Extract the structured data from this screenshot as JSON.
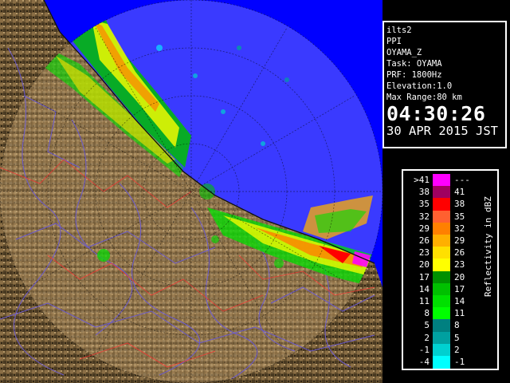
{
  "info": {
    "lines": [
      "ilts2",
      "PPI",
      "OYAMA_Z",
      "Task: OYAMA",
      "PRF: 1800Hz",
      "Elevation:1.0",
      "Max Range:80 km"
    ],
    "time": "04:30:26",
    "date": "30 APR 2015 JST"
  },
  "legend": {
    "title": "Reflectivity in dBZ",
    "rows": [
      {
        "low": ">41",
        "high": "---",
        "color": "#ff00ff"
      },
      {
        "low": "38",
        "high": "41",
        "color": "#a00060"
      },
      {
        "low": "35",
        "high": "38",
        "color": "#ff0000"
      },
      {
        "low": "32",
        "high": "35",
        "color": "#ff6030"
      },
      {
        "low": "29",
        "high": "32",
        "color": "#ff8000"
      },
      {
        "low": "26",
        "high": "29",
        "color": "#ffb000"
      },
      {
        "low": "23",
        "high": "26",
        "color": "#ffe000"
      },
      {
        "low": "20",
        "high": "23",
        "color": "#ffff00"
      },
      {
        "low": "17",
        "high": "20",
        "color": "#009000"
      },
      {
        "low": "14",
        "high": "17",
        "color": "#00c000"
      },
      {
        "low": "11",
        "high": "14",
        "color": "#00e000"
      },
      {
        "low": "8",
        "high": "11",
        "color": "#00ff00"
      },
      {
        "low": "5",
        "high": "8",
        "color": "#008080"
      },
      {
        "low": "2",
        "high": "5",
        "color": "#00a0a0"
      },
      {
        "low": "-1",
        "high": "2",
        "color": "#00d0d0"
      },
      {
        "low": "-4",
        "high": "-1",
        "color": "#00ffff"
      }
    ]
  },
  "colors": {
    "sea": "#0000ff",
    "radar_background": "#0000cc",
    "terrain_dark": "#4a3a22",
    "terrain_light": "#b89a6a",
    "river": "#6a5acd",
    "boundary": "#ff3030"
  }
}
